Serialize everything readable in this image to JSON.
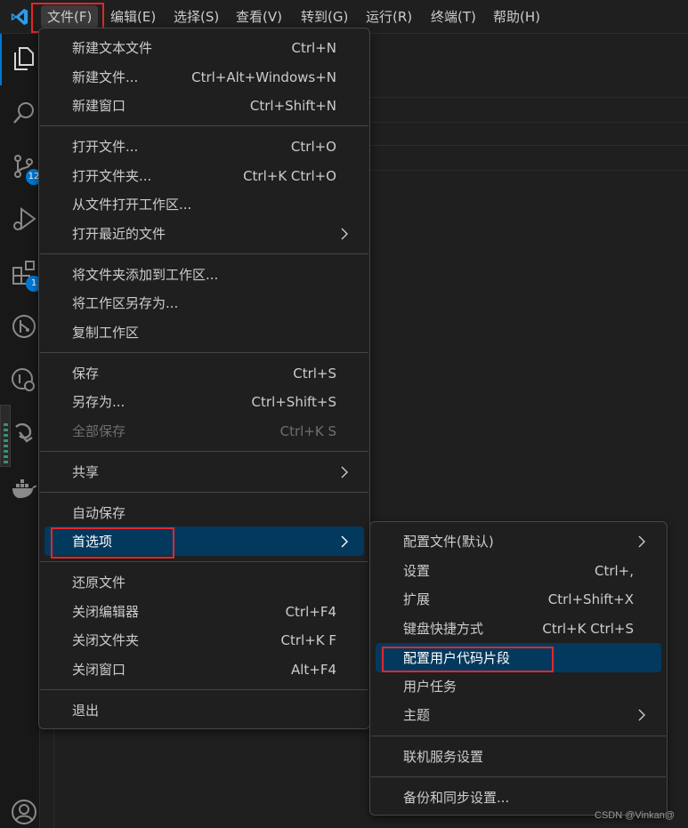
{
  "menubar": {
    "items": [
      {
        "label": "文件(F)"
      },
      {
        "label": "编辑(E)"
      },
      {
        "label": "选择(S)"
      },
      {
        "label": "查看(V)"
      },
      {
        "label": "转到(G)"
      },
      {
        "label": "运行(R)"
      },
      {
        "label": "终端(T)"
      },
      {
        "label": "帮助(H)"
      }
    ]
  },
  "activity_bar": {
    "icons": [
      "explorer-icon",
      "search-icon",
      "source-control-icon",
      "run-debug-icon",
      "extensions-icon",
      "git-graph-icon",
      "remote-explorer-icon",
      "live-share-icon",
      "docker-icon",
      "account-icon"
    ],
    "source_control_badge": "12",
    "extensions_badge": "1"
  },
  "file_menu": {
    "groups": [
      [
        {
          "label": "新建文本文件",
          "shortcut": "Ctrl+N"
        },
        {
          "label": "新建文件...",
          "shortcut": "Ctrl+Alt+Windows+N"
        },
        {
          "label": "新建窗口",
          "shortcut": "Ctrl+Shift+N"
        }
      ],
      [
        {
          "label": "打开文件...",
          "shortcut": "Ctrl+O"
        },
        {
          "label": "打开文件夹...",
          "shortcut": "Ctrl+K Ctrl+O"
        },
        {
          "label": "从文件打开工作区..."
        },
        {
          "label": "打开最近的文件",
          "submenu": true
        }
      ],
      [
        {
          "label": "将文件夹添加到工作区..."
        },
        {
          "label": "将工作区另存为..."
        },
        {
          "label": "复制工作区"
        }
      ],
      [
        {
          "label": "保存",
          "shortcut": "Ctrl+S"
        },
        {
          "label": "另存为...",
          "shortcut": "Ctrl+Shift+S"
        },
        {
          "label": "全部保存",
          "shortcut": "Ctrl+K S",
          "disabled": true
        }
      ],
      [
        {
          "label": "共享",
          "submenu": true
        }
      ],
      [
        {
          "label": "自动保存"
        },
        {
          "label": "首选项",
          "submenu": true,
          "highlighted": true
        }
      ],
      [
        {
          "label": "还原文件"
        },
        {
          "label": "关闭编辑器",
          "shortcut": "Ctrl+F4"
        },
        {
          "label": "关闭文件夹",
          "shortcut": "Ctrl+K F"
        },
        {
          "label": "关闭窗口",
          "shortcut": "Alt+F4"
        }
      ],
      [
        {
          "label": "退出"
        }
      ]
    ]
  },
  "preferences_submenu": {
    "items": [
      {
        "label": "配置文件(默认)",
        "submenu": true
      },
      {
        "label": "设置",
        "shortcut": "Ctrl+,"
      },
      {
        "label": "扩展",
        "shortcut": "Ctrl+Shift+X"
      },
      {
        "label": "键盘快捷方式",
        "shortcut": "Ctrl+K Ctrl+S"
      },
      {
        "label": "配置用户代码片段",
        "highlighted": true
      },
      {
        "label": "用户任务"
      },
      {
        "label": "主题",
        "submenu": true
      },
      {
        "label": "联机服务设置"
      },
      {
        "label": "备份和同步设置..."
      }
    ]
  },
  "watermark": "CSDN @Vinkan@",
  "colors": {
    "background": "#1f1f1f",
    "highlight": "#04395e",
    "annotation_red": "#e0272d",
    "accent": "#0078d4"
  }
}
